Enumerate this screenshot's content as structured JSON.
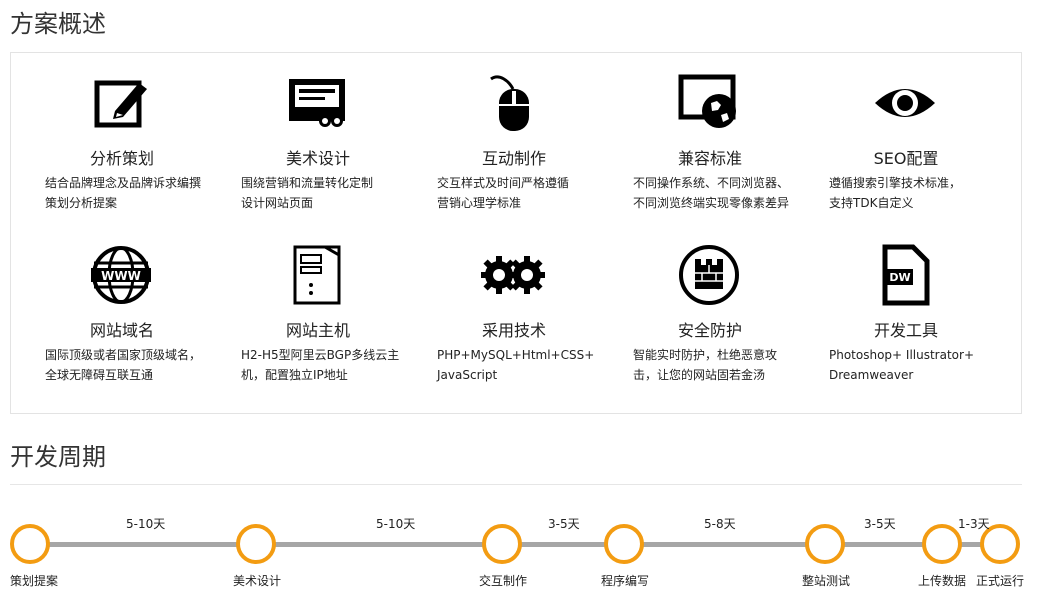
{
  "overview": {
    "title": "方案概述",
    "cards": [
      {
        "icon": "edit-icon",
        "title": "分析策划",
        "lines": [
          "结合品牌理念及品牌诉求编撰",
          "策划分析提案"
        ]
      },
      {
        "icon": "design-board-icon",
        "title": "美术设计",
        "lines": [
          "围绕营销和流量转化定制",
          "设计网站页面"
        ]
      },
      {
        "icon": "mouse-icon",
        "title": "互动制作",
        "lines": [
          "交互样式及时间严格遵循",
          "营销心理学标准"
        ]
      },
      {
        "icon": "globe-monitor-icon",
        "title": "兼容标准",
        "lines": [
          "不同操作系统、不同浏览器、",
          "不同浏览终端实现零像素差异"
        ]
      },
      {
        "icon": "eye-icon",
        "title": "SEO配置",
        "lines": [
          "遵循搜索引擎技术标准，",
          "支持TDK自定义"
        ]
      },
      {
        "icon": "www-globe-icon",
        "title": "网站域名",
        "lines": [
          "国际顶级或者国家顶级域名，",
          "全球无障碍互联互通"
        ]
      },
      {
        "icon": "server-icon",
        "title": "网站主机",
        "lines": [
          "H2-H5型阿里云BGP多线云主",
          "机，配置独立IP地址"
        ]
      },
      {
        "icon": "gears-icon",
        "title": "采用技术",
        "lines": [
          "PHP+MySQL+Html+CSS+",
          "JavaScript"
        ]
      },
      {
        "icon": "shield-wall-icon",
        "title": "安全防护",
        "lines": [
          "智能实时防护，杜绝恶意攻",
          "击，让您的网站固若金汤"
        ]
      },
      {
        "icon": "dw-file-icon",
        "title": "开发工具",
        "lines": [
          "Photoshop+ Illustrator+",
          "Dreamweaver"
        ]
      }
    ]
  },
  "cycle": {
    "title": "开发周期",
    "steps": [
      {
        "label": "策划提案"
      },
      {
        "label": "美术设计"
      },
      {
        "label": "交互制作"
      },
      {
        "label": "程序编写"
      },
      {
        "label": "整站测试"
      },
      {
        "label": "上传数据"
      },
      {
        "label": "正式运行"
      }
    ],
    "durations": [
      "5-10天",
      "5-10天",
      "3-5天",
      "5-8天",
      "3-5天",
      "1-3天"
    ],
    "accent": "#f39c12",
    "line_color": "#a6a6a6"
  }
}
